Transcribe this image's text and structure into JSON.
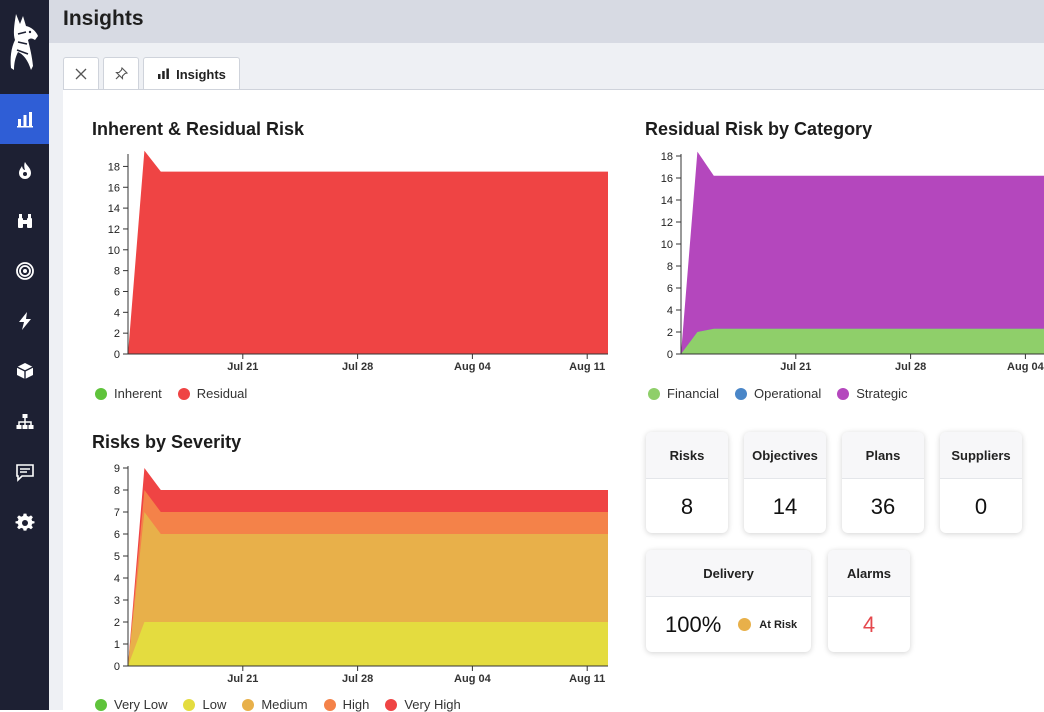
{
  "app": {
    "title": "Insights"
  },
  "sidebar": {
    "items": [
      {
        "name": "insights",
        "icon": "bar-chart-icon",
        "active": true
      },
      {
        "name": "risks",
        "icon": "flame-icon"
      },
      {
        "name": "objectives",
        "icon": "binoculars-icon"
      },
      {
        "name": "targets",
        "icon": "target-icon"
      },
      {
        "name": "plans",
        "icon": "lightning-icon"
      },
      {
        "name": "suppliers",
        "icon": "box-icon"
      },
      {
        "name": "org",
        "icon": "sitemap-icon"
      },
      {
        "name": "messages",
        "icon": "chat-icon"
      },
      {
        "name": "settings",
        "icon": "gear-icon"
      }
    ],
    "accent": "#2f5ed6",
    "background": "#1d2033"
  },
  "tabs": [
    {
      "icon": "close-icon"
    },
    {
      "icon": "pin-icon"
    },
    {
      "icon": "bar-chart-icon",
      "label": "Insights",
      "active": true
    }
  ],
  "charts": {
    "inherent_residual": {
      "title": "Inherent & Residual Risk",
      "legend": [
        {
          "label": "Inherent",
          "color": "#5fc33b"
        },
        {
          "label": "Residual",
          "color": "#ef4444"
        }
      ]
    },
    "residual_by_category": {
      "title": "Residual Risk by Category",
      "legend": [
        {
          "label": "Financial",
          "color": "#8fcf6a"
        },
        {
          "label": "Operational",
          "color": "#4a86c8"
        },
        {
          "label": "Strategic",
          "color": "#b447bd"
        }
      ]
    },
    "by_severity": {
      "title": "Risks by Severity",
      "legend": [
        {
          "label": "Very Low",
          "color": "#5fc33b"
        },
        {
          "label": "Low",
          "color": "#e4dc3f"
        },
        {
          "label": "Medium",
          "color": "#e8b04a"
        },
        {
          "label": "High",
          "color": "#f48249"
        },
        {
          "label": "Very High",
          "color": "#ef4444"
        }
      ]
    }
  },
  "chart_data": [
    {
      "type": "area",
      "title": "Inherent & Residual Risk",
      "x_ticks": [
        "Jul 21",
        "Jul 28",
        "Aug 04",
        "Aug 11"
      ],
      "x": [
        "Jul 14",
        "Jul 15",
        "Jul 16",
        "Aug 13"
      ],
      "ylim": [
        0,
        19
      ],
      "y_ticks": [
        0,
        2,
        4,
        6,
        8,
        10,
        12,
        14,
        16,
        18
      ],
      "series": [
        {
          "name": "Inherent",
          "values": [
            0,
            0,
            0,
            0
          ]
        },
        {
          "name": "Residual",
          "values": [
            0,
            19.5,
            17.5,
            17.5
          ]
        }
      ]
    },
    {
      "type": "area",
      "title": "Residual Risk by Category",
      "stacked": true,
      "x_ticks": [
        "Jul 21",
        "Jul 28",
        "Aug 04"
      ],
      "x": [
        "Jul 14",
        "Jul 15",
        "Jul 16",
        "Aug 13"
      ],
      "ylim": [
        0,
        18
      ],
      "y_ticks": [
        0,
        2,
        4,
        6,
        8,
        10,
        12,
        14,
        16,
        18
      ],
      "series": [
        {
          "name": "Financial",
          "values": [
            0,
            2,
            2.3,
            2.3
          ]
        },
        {
          "name": "Operational",
          "values": [
            0,
            0,
            0,
            0
          ]
        },
        {
          "name": "Strategic",
          "values": [
            0,
            16.4,
            13.9,
            13.9
          ]
        }
      ]
    },
    {
      "type": "area",
      "title": "Risks by Severity",
      "stacked": true,
      "x_ticks": [
        "Jul 21",
        "Jul 28",
        "Aug 04",
        "Aug 11"
      ],
      "x": [
        "Jul 14",
        "Jul 15",
        "Jul 16",
        "Aug 13"
      ],
      "ylim": [
        0,
        9
      ],
      "y_ticks": [
        0,
        1,
        2,
        3,
        4,
        5,
        6,
        7,
        8,
        9
      ],
      "series": [
        {
          "name": "Very Low",
          "values": [
            0,
            0,
            0,
            0
          ]
        },
        {
          "name": "Low",
          "values": [
            0,
            2,
            2,
            2
          ]
        },
        {
          "name": "Medium",
          "values": [
            0,
            5,
            4,
            4
          ]
        },
        {
          "name": "High",
          "values": [
            0,
            1,
            1,
            1
          ]
        },
        {
          "name": "Very High",
          "values": [
            0,
            1,
            1,
            1
          ]
        }
      ]
    }
  ],
  "stats": {
    "risks": {
      "label": "Risks",
      "value": "8"
    },
    "objectives": {
      "label": "Objectives",
      "value": "14"
    },
    "plans": {
      "label": "Plans",
      "value": "36"
    },
    "suppliers": {
      "label": "Suppliers",
      "value": "0"
    },
    "delivery": {
      "label": "Delivery",
      "value": "100%",
      "status": "At Risk",
      "status_color": "#e8b04a"
    },
    "alarms": {
      "label": "Alarms",
      "value": "4",
      "value_color": "#e5484d"
    }
  }
}
